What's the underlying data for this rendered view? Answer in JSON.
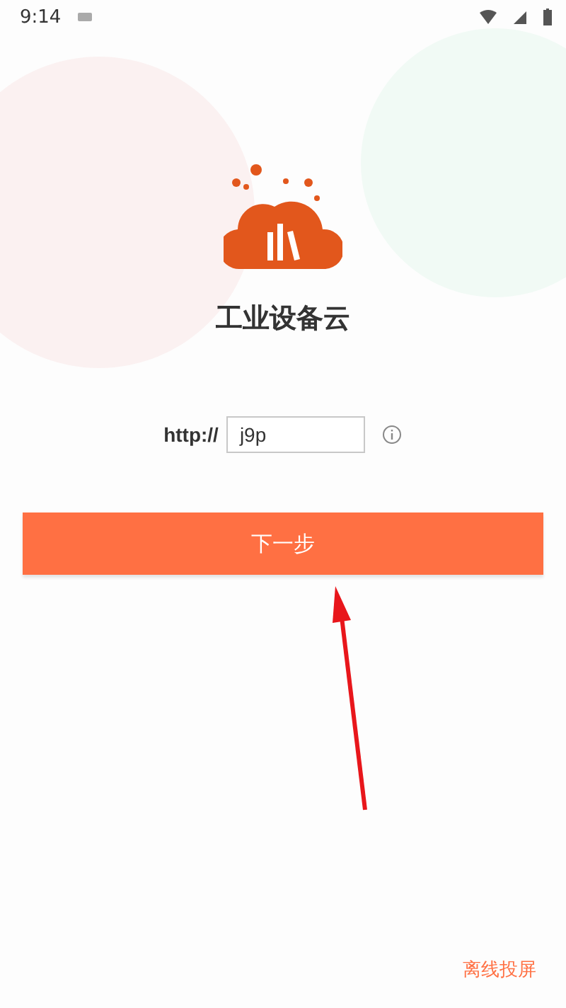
{
  "status_bar": {
    "time": "9:14"
  },
  "app": {
    "title": "工业设备云"
  },
  "server": {
    "prefix": "http://",
    "value": "j9p"
  },
  "next_button": {
    "label": "下一步"
  },
  "footer_link": {
    "label": "离线投屏"
  }
}
